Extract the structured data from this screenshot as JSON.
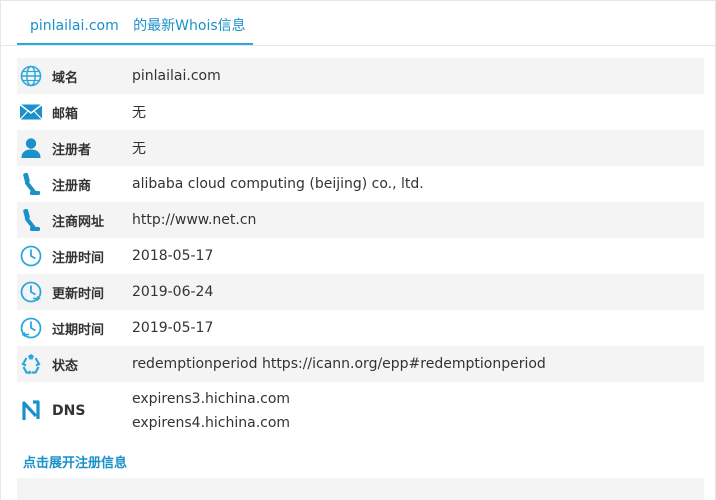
{
  "header": {
    "domain": "pinlailai.com",
    "suffix": "的最新Whois信息"
  },
  "rows": [
    {
      "label": "域名",
      "value": "pinlailai.com",
      "icon": "globe-icon"
    },
    {
      "label": "邮箱",
      "value": "无",
      "icon": "mail-icon"
    },
    {
      "label": "注册者",
      "value": "无",
      "icon": "user-icon"
    },
    {
      "label": "注册商",
      "value": "alibaba cloud computing (beijing) co., ltd.",
      "icon": "registrar-icon"
    },
    {
      "label": "注商网址",
      "value": "http://www.net.cn",
      "icon": "registrar-url-icon"
    },
    {
      "label": "注册时间",
      "value": "2018-05-17",
      "icon": "clock-icon"
    },
    {
      "label": "更新时间",
      "value": "2019-06-24",
      "icon": "clock-update-icon"
    },
    {
      "label": "过期时间",
      "value": "2019-05-17",
      "icon": "clock-expire-icon"
    },
    {
      "label": "状态",
      "value": "redemptionperiod https://icann.org/epp#redemptionperiod",
      "icon": "recycle-icon"
    }
  ],
  "dns": {
    "label": "DNS",
    "servers": [
      "expirens3.hichina.com",
      "expirens4.hichina.com"
    ],
    "icon": "dns-icon"
  },
  "expand_link": "点击展开注册信息",
  "colors": {
    "accent": "#2ba7dc",
    "link": "#1a91c9",
    "row_shade": "#f4f4f4"
  }
}
